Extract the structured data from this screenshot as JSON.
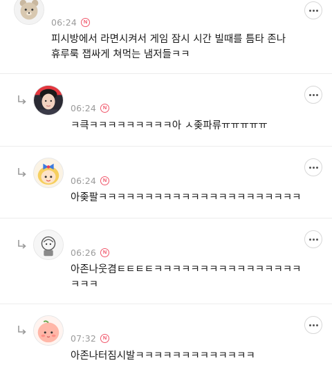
{
  "comments": [
    {
      "time": "06:24",
      "badge": "N",
      "text": "피시방에서 라면시켜서 게임 잠시 시간 빌때를 틈타 존나\n휴루룩 잽싸게 쳐먹는 냄저들ㅋㅋ",
      "avatar_icon": "bear-avatar-icon"
    },
    {
      "time": "06:24",
      "badge": "N",
      "text": "ㅋ큭ㅋㅋㅋㅋㅋㅋㅋㅋㅋ아 ㅅ좆파류ㅠㅠㅠㅠㅠ",
      "avatar_icon": "person-avatar-icon"
    },
    {
      "time": "06:24",
      "badge": "N",
      "text": "아좆팔ㅋㅋㅋㅋㅋㅋㅋㅋㅋㅋㅋㅋㅋㅋㅋㅋㅋㅋㅋㅋㅋㅋ",
      "avatar_icon": "cartoon-girl-avatar-icon"
    },
    {
      "time": "06:26",
      "badge": "N",
      "text": "아존나웃겸ㅌㅌㅌㅌㅋㅋㅋㅋㅋㅋㅋㅋㅋㅋㅋㅋㅋㅋㅋㅋ\nㅋㅋㅋ",
      "avatar_icon": "sketch-avatar-icon"
    },
    {
      "time": "07:32",
      "badge": "N",
      "text": "아존나터짐시발ㅋㅋㅋㅋㅋㅋㅋㅋㅋㅋㅋㅋㅋ",
      "avatar_icon": "peach-avatar-icon"
    }
  ]
}
